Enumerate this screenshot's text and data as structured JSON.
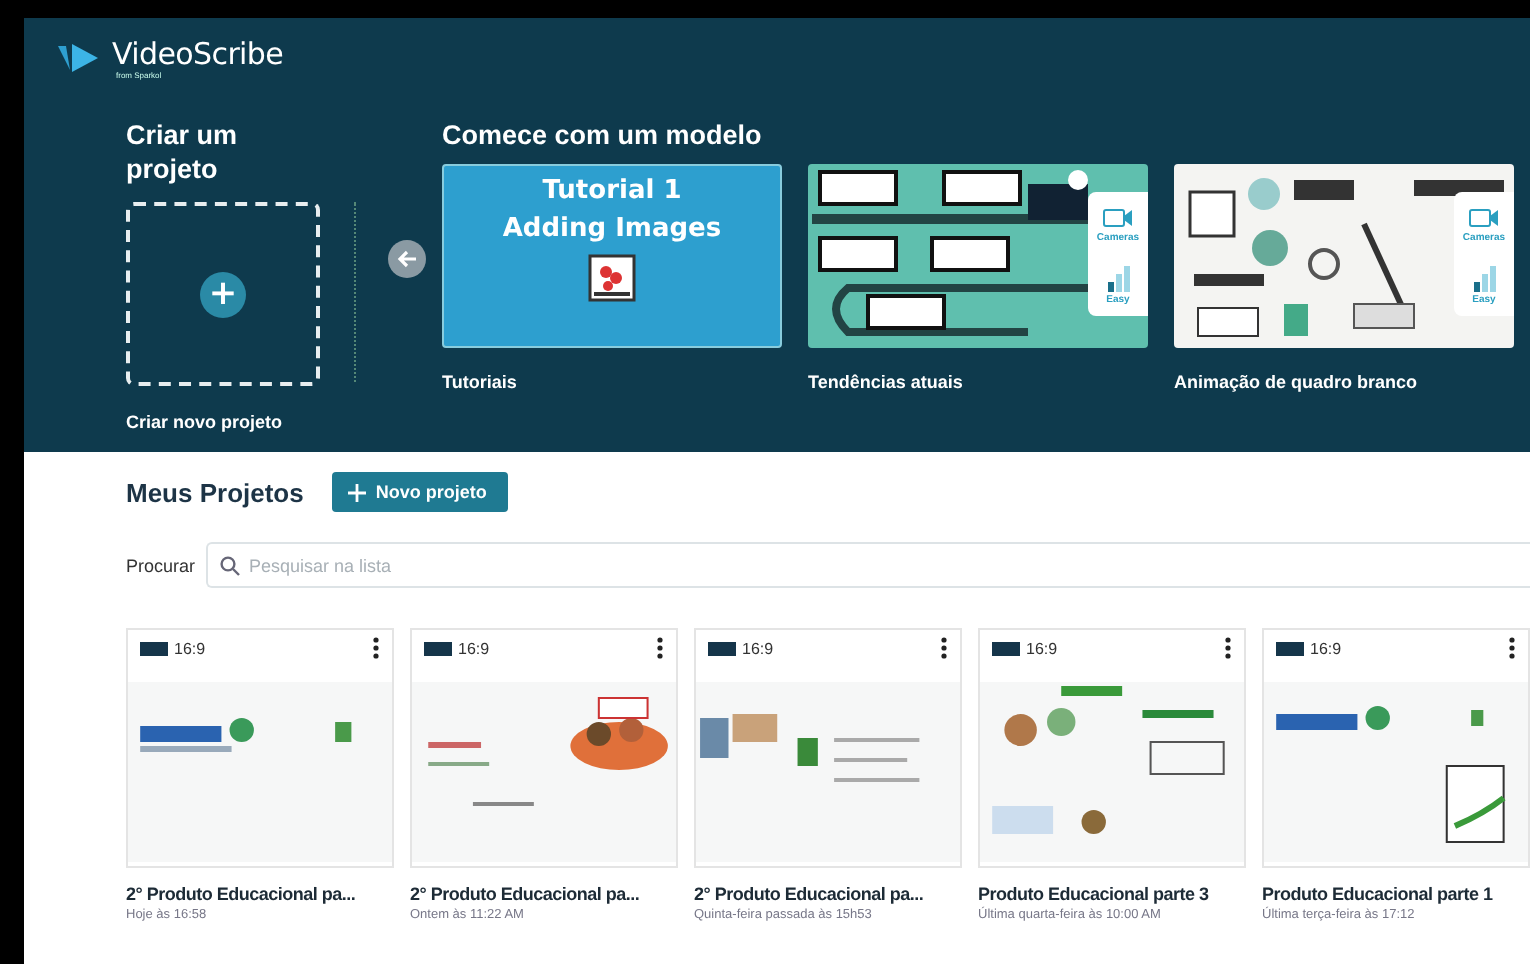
{
  "header": {
    "logo": "VideoScribe",
    "logo_sub": "from Sparkol"
  },
  "create": {
    "title": "Criar um projeto",
    "label": "Criar novo projeto",
    "button": "+"
  },
  "templates": {
    "title": "Comece com um modelo",
    "items": [
      {
        "kind": "title",
        "lines": [
          "Tutorial 1",
          "Adding Images"
        ],
        "label": "Tutoriais"
      },
      {
        "kind": "picture",
        "badges": [
          "Cameras",
          "Easy"
        ],
        "label": "Tendências atuais"
      },
      {
        "kind": "picture",
        "badges": [
          "Cameras",
          "Easy"
        ],
        "label": "Animação de quadro branco"
      }
    ]
  },
  "projects": {
    "title": "Meus Projetos",
    "new_button": "Novo projeto",
    "search_label": "Procurar",
    "search": {
      "placeholder": "Pesquisar na lista"
    },
    "items": [
      {
        "ratio": "16:9",
        "title": "2° Produto Educacional pa...",
        "date": "Hoje às 16:58"
      },
      {
        "ratio": "16:9",
        "title": "2° Produto Educacional pa...",
        "date": "Ontem às 11:22 AM"
      },
      {
        "ratio": "16:9",
        "title": "2° Produto Educacional pa...",
        "date": "Quinta-feira passada às 15h53"
      },
      {
        "ratio": "16:9",
        "title": "Produto Educacional parte 3",
        "date": "Última quarta-feira às 10:00 AM"
      },
      {
        "ratio": "16:9",
        "title": "Produto Educacional parte 1",
        "date": "Última terça-feira às 17:12"
      }
    ]
  }
}
